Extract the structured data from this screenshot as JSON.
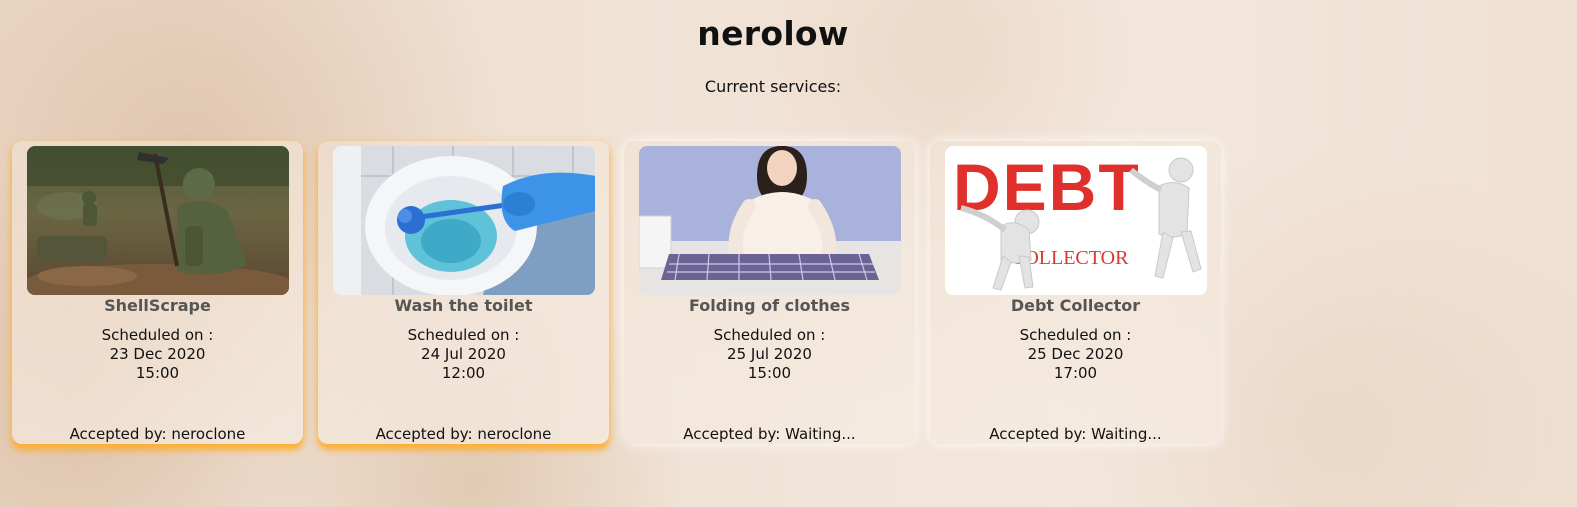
{
  "header": {
    "username": "nerolow",
    "subtitle": "Current services:"
  },
  "services": [
    {
      "title": "ShellScrape",
      "scheduled_label": "Scheduled on :",
      "date": "23 Dec 2020",
      "time": "15:00",
      "accepted_label": "Accepted by:",
      "accepted_by": "neroclone",
      "accepted_text": "Accepted by: neroclone",
      "image": "soldier-digging-photo",
      "highlight_color": "#ffaa1e"
    },
    {
      "title": "Wash the toilet",
      "scheduled_label": "Scheduled on :",
      "date": "24 Jul 2020",
      "time": "12:00",
      "accepted_label": "Accepted by:",
      "accepted_by": "neroclone",
      "accepted_text": "Accepted by: neroclone",
      "image": "toilet-brush-photo",
      "highlight_color": "#ffaa1e"
    },
    {
      "title": "Folding of clothes",
      "scheduled_label": "Scheduled on :",
      "date": "25 Jul 2020",
      "time": "15:00",
      "accepted_label": "Accepted by:",
      "accepted_by": "Waiting...",
      "accepted_text": "Accepted by: Waiting...",
      "image": "folding-clothes-photo"
    },
    {
      "title": "Debt Collector",
      "scheduled_label": "Scheduled on :",
      "date": "25 Dec 2020",
      "time": "17:00",
      "accepted_label": "Accepted by:",
      "accepted_by": "Waiting...",
      "accepted_text": "Accepted by: Waiting...",
      "image": "debt-collector-illustration",
      "image_text": [
        "DEBT",
        "COLLECTOR"
      ]
    }
  ]
}
